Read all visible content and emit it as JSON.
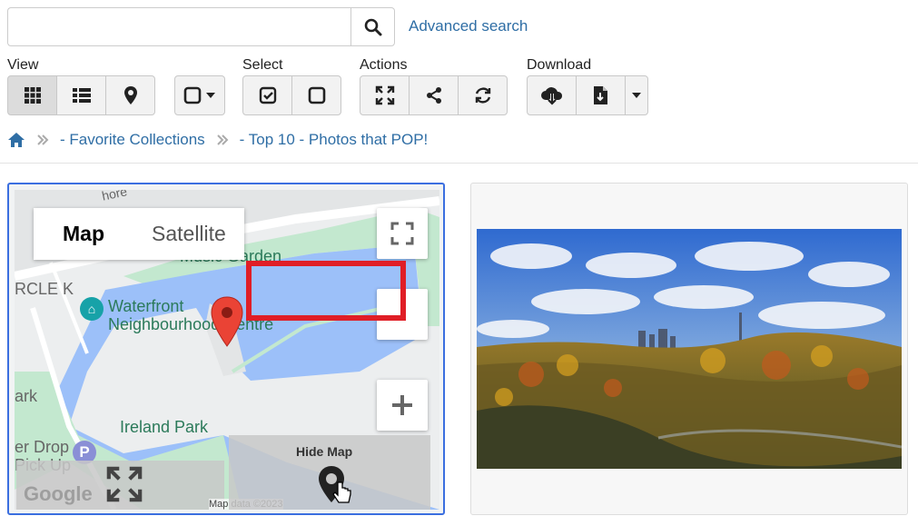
{
  "search": {
    "placeholder": "",
    "value": "",
    "advanced_link": "Advanced search"
  },
  "toolbar": {
    "view": {
      "label": "View",
      "buttons": [
        "grid-icon",
        "list-icon",
        "map-marker-icon"
      ]
    },
    "select_dropdown": "square-icon",
    "select": {
      "label": "Select",
      "buttons": [
        "check-square-icon",
        "square-icon"
      ]
    },
    "actions": {
      "label": "Actions",
      "buttons": [
        "expand-icon",
        "share-icon",
        "refresh-icon"
      ]
    },
    "download": {
      "label": "Download",
      "buttons": [
        "cloud-download-icon",
        "file-download-icon",
        "caret-down-icon"
      ]
    }
  },
  "breadcrumb": {
    "items": [
      "- Favorite Collections",
      "- Top 10 - Photos that POP!"
    ]
  },
  "map": {
    "type_map": "Map",
    "type_satellite": "Satellite",
    "labels": {
      "music_garden": "Music Garden",
      "waterfront_line1": "Waterfront",
      "waterfront_line2": "Neighbourhood Centre",
      "rcle": "RCLE K",
      "ark": "ark",
      "ireland_park": "Ireland Park",
      "drop": "er Drop",
      "pickup": "Pick Up",
      "shore": "hore"
    },
    "hide_map_label": "Hide Map",
    "google_watermark": "Google",
    "attribution": "Map data ©2023"
  },
  "colors": {
    "accent": "#2f6ea5",
    "highlight": "#e01e26",
    "water": "#9cc0f9",
    "park": "#c3e8cf"
  }
}
